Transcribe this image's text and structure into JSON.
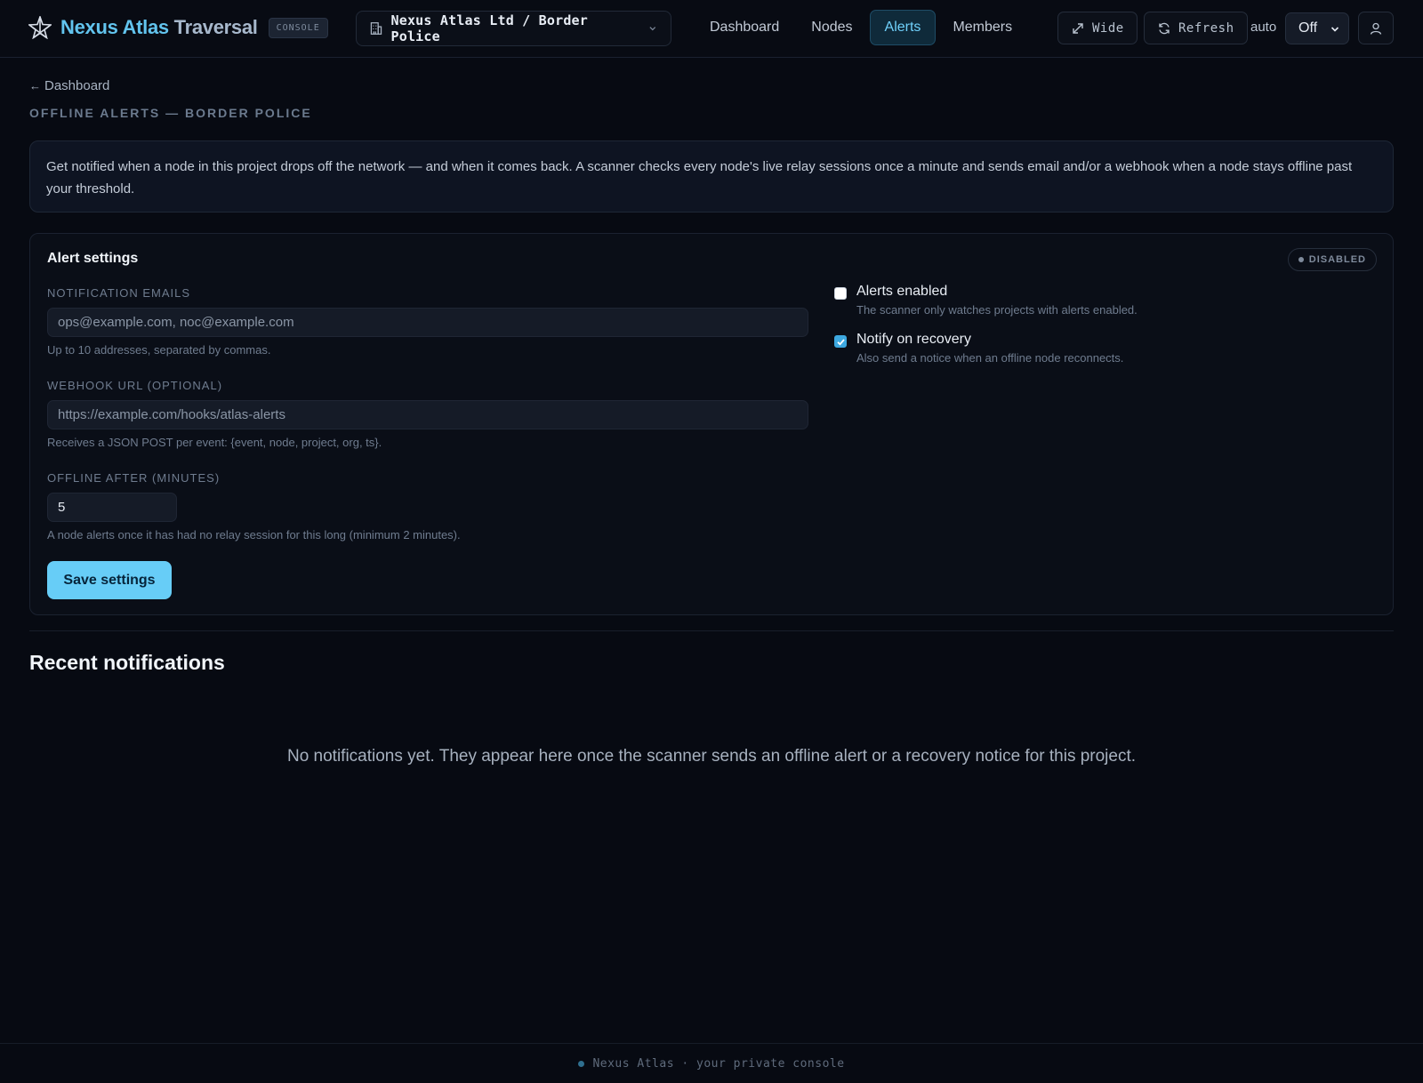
{
  "app": {
    "brand_primary": "Nexus Atlas",
    "brand_secondary": "Traversal",
    "console_badge": "CONSOLE",
    "org_label": "Nexus Atlas Ltd / Border Police"
  },
  "nav": {
    "items": [
      {
        "label": "Dashboard",
        "active": false
      },
      {
        "label": "Nodes",
        "active": false
      },
      {
        "label": "Alerts",
        "active": true
      },
      {
        "label": "Members",
        "active": false
      }
    ]
  },
  "toolbar": {
    "wide_label": "Wide",
    "refresh_label": "Refresh",
    "auto_label": "auto",
    "auto_value": "Off"
  },
  "page": {
    "breadcrumb": "Dashboard",
    "title": "OFFLINE ALERTS — BORDER POLICE",
    "info": "Get notified when a node in this project drops off the network — and when it comes back. A scanner checks every node's live relay sessions once a minute and sends email and/or a webhook when a node stays offline past your threshold."
  },
  "settings": {
    "title": "Alert settings",
    "status": "DISABLED",
    "emails_label": "NOTIFICATION EMAILS",
    "emails_placeholder": "ops@example.com, noc@example.com",
    "emails_hint": "Up to 10 addresses, separated by commas.",
    "webhook_label": "WEBHOOK URL (OPTIONAL)",
    "webhook_placeholder": "https://example.com/hooks/atlas-alerts",
    "webhook_hint": "Receives a JSON POST per event: {event, node, project, org, ts}.",
    "offline_label": "OFFLINE AFTER (MINUTES)",
    "offline_value": "5",
    "offline_hint": "A node alerts once it has had no relay session for this long (minimum 2 minutes).",
    "save_label": "Save settings",
    "alerts_enabled": {
      "title": "Alerts enabled",
      "desc": "The scanner only watches projects with alerts enabled.",
      "checked": false
    },
    "notify_recovery": {
      "title": "Notify on recovery",
      "desc": "Also send a notice when an offline node reconnects.",
      "checked": true
    }
  },
  "notifications": {
    "title": "Recent notifications",
    "empty": "No notifications yet. They appear here once the scanner sends an offline alert or a recovery notice for this project."
  },
  "footer": {
    "text": "Nexus Atlas · your private console"
  },
  "colors": {
    "accent": "#67cdf7",
    "background": "#070a12"
  }
}
